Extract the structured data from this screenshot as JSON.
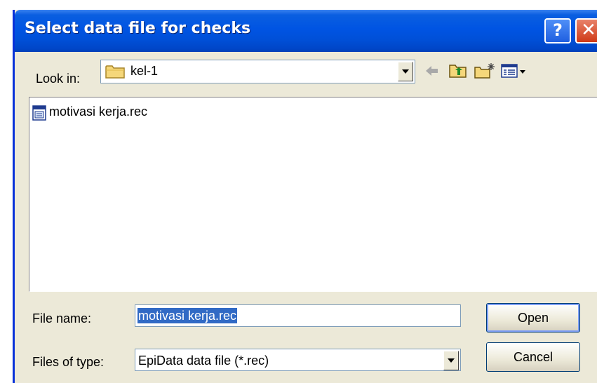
{
  "window": {
    "title": "Select data file for checks",
    "help_glyph": "?",
    "close_glyph": "✕"
  },
  "lookin": {
    "label": "Look in:",
    "value": "kel-1",
    "icon": "folder-icon"
  },
  "toolbar": {
    "icons": [
      "back-arrow-icon",
      "up-folder-icon",
      "new-folder-icon",
      "view-menu-icon"
    ]
  },
  "files": [
    {
      "name": "motivasi kerja.rec",
      "icon": "rec-file-icon"
    }
  ],
  "filename": {
    "label": "File name:",
    "value": "motivasi kerja.rec"
  },
  "filetype": {
    "label": "Files of type:",
    "value": "EpiData data file (*.rec)"
  },
  "buttons": {
    "open": "Open",
    "cancel": "Cancel"
  },
  "colors": {
    "titlebar": "#0054e3",
    "dialog_bg": "#ece9d8",
    "selection": "#316ac5"
  }
}
